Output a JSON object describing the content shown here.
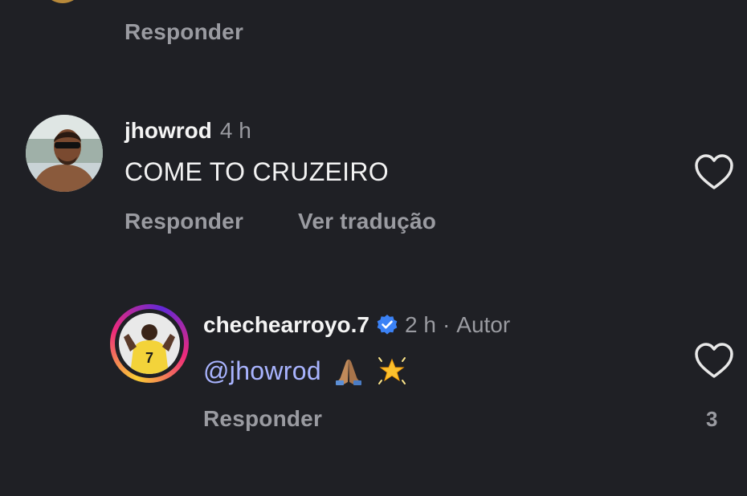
{
  "comment_prev": {
    "reply_label": "Responder"
  },
  "comment_1": {
    "username": "jhowrod",
    "time": "4 h",
    "text": "COME TO CRUZEIRO",
    "reply_label": "Responder",
    "translate_label": "Ver tradução",
    "avatar_icon": "profile-photo-man-sunglasses"
  },
  "reply_1": {
    "username": "chechearroyo.7",
    "verified_icon": "verified-badge-icon",
    "time": "2 h",
    "separator": "·",
    "author_label": "Autor",
    "mention": "@jhowrod",
    "emojis": [
      "folded-hands-emoji",
      "glowing-star-emoji"
    ],
    "reply_label": "Responder",
    "like_count": "3",
    "avatar_icon": "profile-photo-jersey-7-story-ring"
  },
  "colors": {
    "background": "#1f2025",
    "muted": "#9a9ba1",
    "mention": "#a9b4ff",
    "verified": "#3b82f6"
  }
}
